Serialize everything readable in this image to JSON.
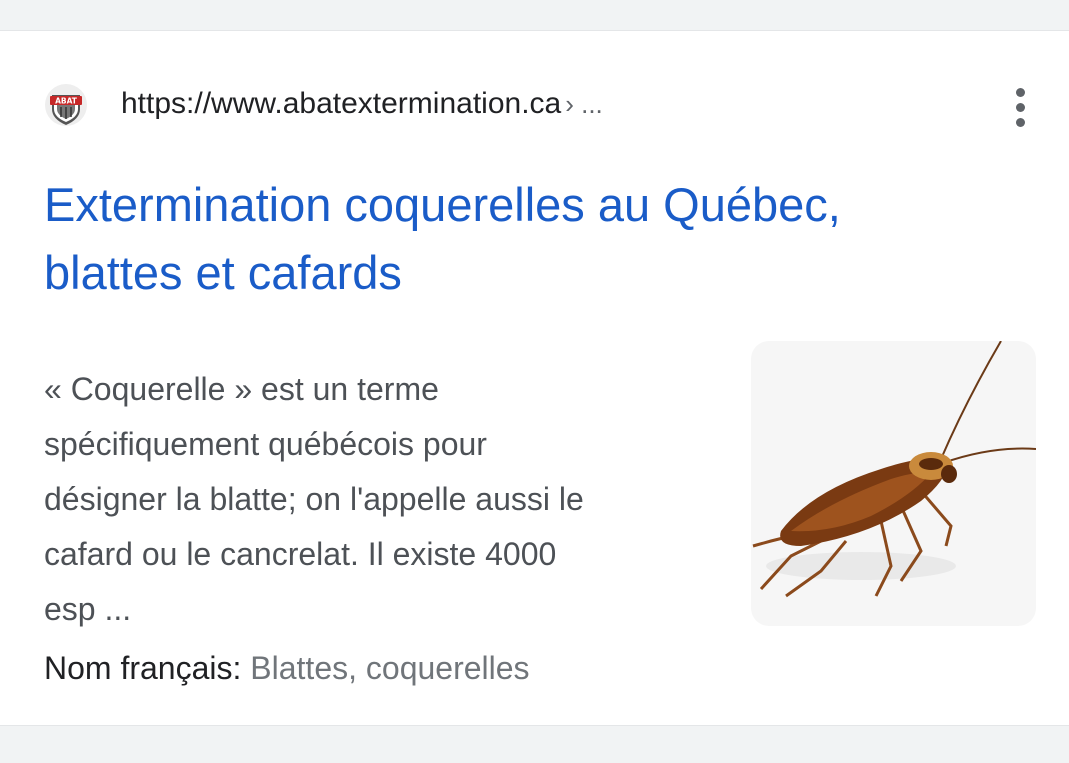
{
  "result": {
    "url": "https://www.abatextermination.ca",
    "breadcrumb": "› ...",
    "favicon_icon": "abat-shield-logo",
    "favicon_text": "ABAT",
    "title_line1": "Extermination coquerelles au Québec,",
    "title_line2": "blattes et cafards",
    "snippet_lines": [
      "« Coquerelle » est un terme",
      "spécifiquement québécois pour",
      "désigner la blatte; on l'appelle aussi le",
      "cafard ou le cancrelat. Il existe 4000",
      "esp ..."
    ],
    "attribute_label": "Nom français:",
    "attribute_value": "Blattes, coquerelles",
    "thumbnail": "cockroach-image",
    "menu_icon": "more-vert-icon"
  },
  "colors": {
    "title": "#1a5cc8",
    "url": "#202124",
    "snippet": "#4d5156",
    "attribute_value": "#70757a",
    "background": "#f1f3f4"
  }
}
